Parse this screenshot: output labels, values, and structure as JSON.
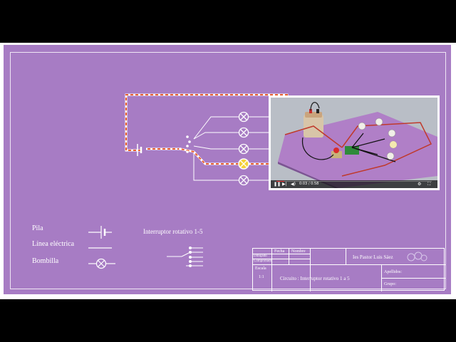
{
  "legend": {
    "pila": "Pila",
    "linea": "Línea eléctrica",
    "bombilla": "Bombilla",
    "interruptor": "Interruptor rotativo 1-5"
  },
  "title_block": {
    "fecha": "Fecha",
    "nombre": "Nombre",
    "dibujado": "Dibujado",
    "comprobado": "Comprobado",
    "escala_label": "Escala",
    "escala_value": "1:1",
    "school": "Ies Pastor Luis Sáez",
    "circuit": "Circuito : Interruptor rotativo 1 a 5",
    "apellidos": "Apellidos:",
    "grupo": "Grupo:"
  },
  "video": {
    "time": "0:03 / 0:58",
    "progress": 0.05,
    "icons": [
      "play-icon",
      "next-icon",
      "volume-icon",
      "settings-icon",
      "fullscreen-icon"
    ]
  },
  "colors": {
    "sheet": "#a77cc4",
    "wire": "#ffffff",
    "active_wire": "#e8612f",
    "lit_bulb": "#f5d13a"
  },
  "bulbs_lit": [
    false,
    false,
    false,
    true,
    false
  ]
}
